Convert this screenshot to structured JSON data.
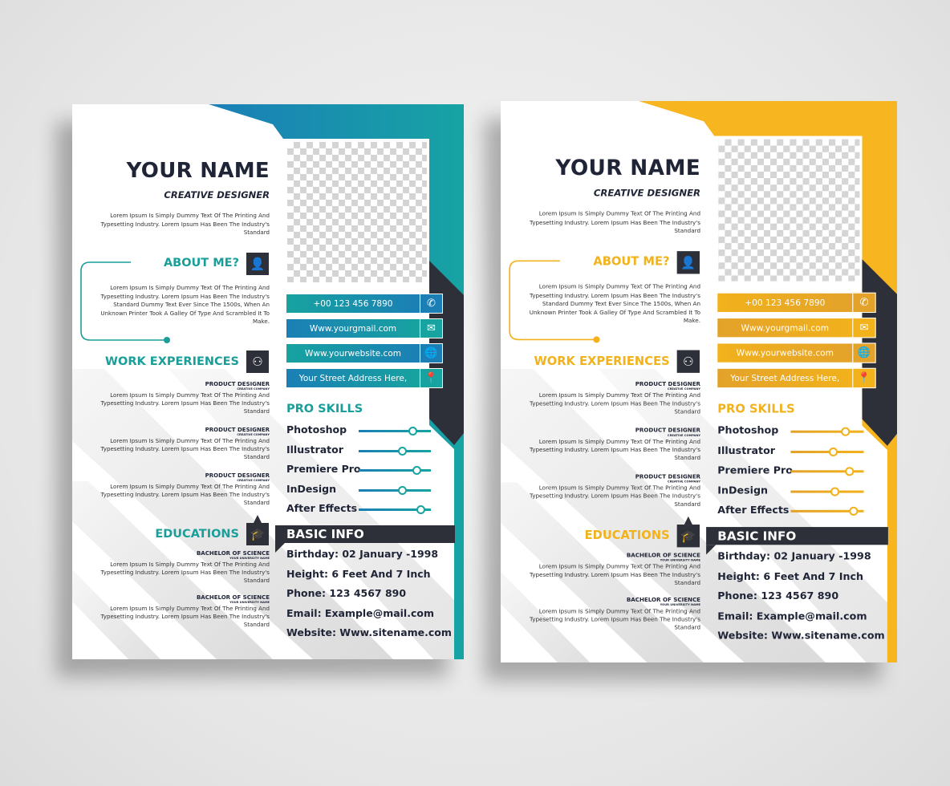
{
  "resumes": [
    {
      "theme": {
        "accent": "#1a9e9a",
        "grad1": "#1a7fb8",
        "grad2": "#17a3a3",
        "dark": "#2d3038",
        "bar_a": "#17a3a0",
        "bar_b": "#1b7fb5"
      },
      "name": "YOUR NAME",
      "title": "CREATIVE DESIGNER",
      "intro": "Lorem Ipsum Is Simply Dummy Text Of The Printing And Typesetting Industry. Lorem Ipsum Has Been The Industry's Standard",
      "about": {
        "heading": "ABOUT ME?",
        "icon": "user-icon",
        "text": "Lorem Ipsum Is Simply Dummy Text Of The Printing And Typesetting Industry. Lorem Ipsum Has Been The Industry's Standard Dummy Text Ever Since The 1500s, When An Unknown Printer Took A Galley Of Type And Scrambled It To Make."
      },
      "work": {
        "heading": "WORK EXPERIENCES",
        "icon": "team-icon",
        "items": [
          {
            "title": "PRODUCT DESIGNER",
            "company": "CREATIVE COMPANY",
            "text": "Lorem Ipsum Is Simply Dummy Text Of The Printing And Typesetting Industry. Lorem Ipsum Has Been The Industry's Standard"
          },
          {
            "title": "PRODUCT DESIGNER",
            "company": "CREATIVE COMPANY",
            "text": "Lorem Ipsum Is Simply Dummy Text Of The Printing And Typesetting Industry. Lorem Ipsum Has Been The Industry's Standard"
          },
          {
            "title": "PRODUCT DESIGNER",
            "company": "CREATIVE COMPANY",
            "text": "Lorem Ipsum Is Simply Dummy Text Of The Printing And Typesetting Industry. Lorem Ipsum Has Been The Industry's Standard"
          }
        ]
      },
      "education": {
        "heading": "EDUCATIONS",
        "icon": "graduate-icon",
        "items": [
          {
            "title": "BACHELOR OF SCIENCE",
            "school": "YOUR UNIVERSITY NAME",
            "text": "Lorem Ipsum Is Simply Dummy Text Of The Printing And Typesetting Industry. Lorem Ipsum Has Been The Industry's Standard"
          },
          {
            "title": "BACHELOR OF SCIENCE",
            "school": "YOUR UNIVERSITY NAME",
            "text": "Lorem Ipsum Is Simply Dummy Text Of The Printing And Typesetting Industry. Lorem Ipsum Has Been The Industry's Standard"
          }
        ]
      },
      "contacts": [
        {
          "text": "+00 123 456 7890",
          "icon": "phone-icon"
        },
        {
          "text": "Www.yourgmail.com",
          "icon": "mail-icon"
        },
        {
          "text": "Www.yourwebsite.com",
          "icon": "globe-icon"
        },
        {
          "text": "Your Street Address Here,",
          "icon": "location-pin-icon"
        }
      ],
      "skills": {
        "heading": "PRO SKILLS",
        "items": [
          {
            "name": "Photoshop",
            "level": 75
          },
          {
            "name": "Illustrator",
            "level": 60
          },
          {
            "name": "Premiere Pro",
            "level": 80
          },
          {
            "name": "InDesign",
            "level": 60
          },
          {
            "name": "After Effects",
            "level": 86
          }
        ]
      },
      "basic_info": {
        "heading": "BASIC INFO",
        "lines": [
          "Birthday: 02 January -1998",
          "Height: 6 Feet And 7 Inch",
          "Phone: 123 4567 890",
          "Email: Example@mail.com",
          "Website: Www.sitename.com"
        ]
      }
    },
    {
      "theme": {
        "accent": "#f2b21c",
        "grad1": "#f7b51f",
        "grad2": "#f7b51f",
        "dark": "#2d3038",
        "bar_a": "#f2b21c",
        "bar_b": "#e3a22a"
      },
      "name": "YOUR NAME",
      "title": "CREATIVE DESIGNER",
      "intro": "Lorem Ipsum Is Simply Dummy Text Of The Printing And Typesetting Industry. Lorem Ipsum Has Been The Industry's Standard",
      "about": {
        "heading": "ABOUT ME?",
        "icon": "user-icon",
        "text": "Lorem Ipsum Is Simply Dummy Text Of The Printing And Typesetting Industry. Lorem Ipsum Has Been The Industry's Standard Dummy Text Ever Since The 1500s, When An Unknown Printer Took A Galley Of Type And Scrambled It To Make."
      },
      "work": {
        "heading": "WORK EXPERIENCES",
        "icon": "team-icon",
        "items": [
          {
            "title": "PRODUCT DESIGNER",
            "company": "CREATIVE COMPANY",
            "text": "Lorem Ipsum Is Simply Dummy Text Of The Printing And Typesetting Industry. Lorem Ipsum Has Been The Industry's Standard"
          },
          {
            "title": "PRODUCT DESIGNER",
            "company": "CREATIVE COMPANY",
            "text": "Lorem Ipsum Is Simply Dummy Text Of The Printing And Typesetting Industry. Lorem Ipsum Has Been The Industry's Standard"
          },
          {
            "title": "PRODUCT DESIGNER",
            "company": "CREATIVE COMPANY",
            "text": "Lorem Ipsum Is Simply Dummy Text Of The Printing And Typesetting Industry. Lorem Ipsum Has Been The Industry's Standard"
          }
        ]
      },
      "education": {
        "heading": "EDUCATIONS",
        "icon": "graduate-icon",
        "items": [
          {
            "title": "BACHELOR OF SCIENCE",
            "school": "YOUR UNIVERSITY NAME",
            "text": "Lorem Ipsum Is Simply Dummy Text Of The Printing And Typesetting Industry. Lorem Ipsum Has Been The Industry's Standard"
          },
          {
            "title": "BACHELOR OF SCIENCE",
            "school": "YOUR UNIVERSITY NAME",
            "text": "Lorem Ipsum Is Simply Dummy Text Of The Printing And Typesetting Industry. Lorem Ipsum Has Been The Industry's Standard"
          }
        ]
      },
      "contacts": [
        {
          "text": "+00 123 456 7890",
          "icon": "phone-icon"
        },
        {
          "text": "Www.yourgmail.com",
          "icon": "mail-icon"
        },
        {
          "text": "Www.yourwebsite.com",
          "icon": "globe-icon"
        },
        {
          "text": "Your Street Address Here,",
          "icon": "location-pin-icon"
        }
      ],
      "skills": {
        "heading": "PRO SKILLS",
        "items": [
          {
            "name": "Photoshop",
            "level": 75
          },
          {
            "name": "Illustrator",
            "level": 58
          },
          {
            "name": "Premiere Pro",
            "level": 80
          },
          {
            "name": "InDesign",
            "level": 60
          },
          {
            "name": "After Effects",
            "level": 86
          }
        ]
      },
      "basic_info": {
        "heading": "BASIC INFO",
        "lines": [
          "Birthday: 02 January -1998",
          "Height: 6 Feet And 7 Inch",
          "Phone: 123 4567 890",
          "Email: Example@mail.com",
          "Website: Www.sitename.com"
        ]
      }
    }
  ]
}
